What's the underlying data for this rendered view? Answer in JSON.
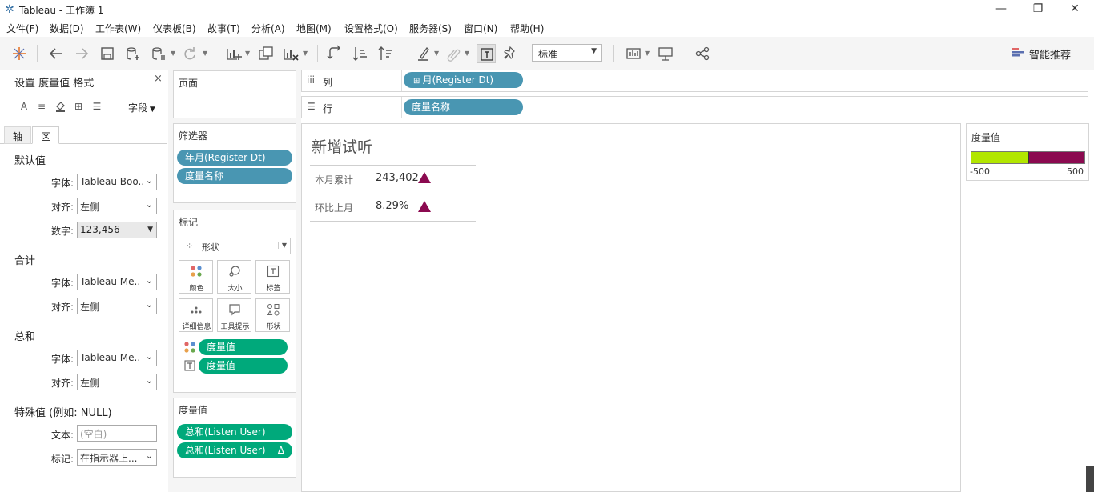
{
  "window": {
    "title": "Tableau - 工作簿 1",
    "minimize": "—",
    "restore": "❐",
    "close": "✕"
  },
  "menu": [
    "文件(F)",
    "数据(D)",
    "工作表(W)",
    "仪表板(B)",
    "故事(T)",
    "分析(A)",
    "地图(M)",
    "设置格式(O)",
    "服务器(S)",
    "窗口(N)",
    "帮助(H)"
  ],
  "toolbar": {
    "fit": "标准",
    "recommend": "智能推荐"
  },
  "format_pane": {
    "title": "设置 度量值 格式",
    "close": "×",
    "fields_label": "字段",
    "tabs": [
      "轴",
      "区"
    ],
    "sections": {
      "default": {
        "title": "默认值",
        "font_label": "字体:",
        "font_value": "Tableau Boo..",
        "align_label": "对齐:",
        "align_value": "左侧",
        "number_label": "数字:",
        "number_value": "123,456"
      },
      "total": {
        "title": "合计",
        "font_label": "字体:",
        "font_value": "Tableau Me..",
        "align_label": "对齐:",
        "align_value": "左侧"
      },
      "grand_total": {
        "title": "总和",
        "font_label": "字体:",
        "font_value": "Tableau Me..",
        "align_label": "对齐:",
        "align_value": "左侧"
      },
      "special": {
        "title": "特殊值 (例如: NULL)",
        "text_label": "文本:",
        "text_placeholder": "(空白)",
        "marks_label": "标记:",
        "marks_value": "在指示器上..."
      }
    }
  },
  "pages": {
    "title": "页面"
  },
  "filters": {
    "title": "筛选器",
    "pills": [
      "年月(Register Dt)",
      "度量名称"
    ]
  },
  "marks": {
    "title": "标记",
    "type": "形状",
    "buttons": [
      "颜色",
      "大小",
      "标签",
      "详细信息",
      "工具提示",
      "形状"
    ],
    "pills": [
      "度量值",
      "度量值"
    ]
  },
  "measure_values": {
    "title": "度量值",
    "pills": [
      "总和(Listen User)",
      "总和(Listen User)"
    ],
    "delta": "Δ"
  },
  "columns": {
    "label": "列",
    "pill": "月(Register Dt)"
  },
  "rows": {
    "label": "行",
    "pill": "度量名称"
  },
  "viz": {
    "title": "新增试听",
    "rows": [
      {
        "label": "本月累计",
        "value": "243,402"
      },
      {
        "label": "环比上月",
        "value": "8.29%"
      }
    ],
    "triangle_color": "#8b0a50"
  },
  "legend": {
    "title": "度量值",
    "min": "-500",
    "max": "500",
    "low_color": "#b2e600",
    "high_color": "#8b0a50"
  }
}
